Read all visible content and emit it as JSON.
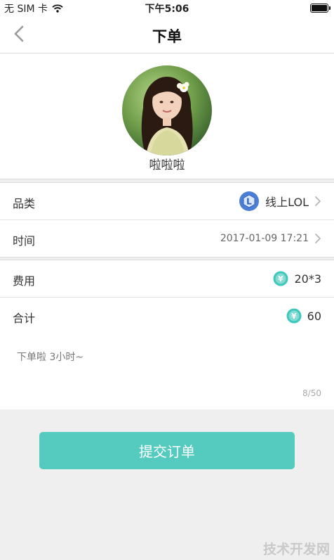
{
  "status_bar": {
    "carrier": "无 SIM 卡",
    "time": "下午5:06"
  },
  "nav": {
    "title": "下单"
  },
  "profile": {
    "name": "啦啦啦"
  },
  "order_rows": [
    {
      "label": "品类",
      "value": "线上LOL",
      "icon": "lol-game-icon"
    },
    {
      "label": "时间",
      "value": "2017-01-09 17:21"
    }
  ],
  "fee_rows": [
    {
      "label": "费用",
      "value": "20*3",
      "icon": "coin-icon"
    },
    {
      "label": "合计",
      "value": "60",
      "icon": "coin-icon"
    }
  ],
  "note": {
    "text": "下单啦 3小时~",
    "count": "8/50"
  },
  "submit": {
    "label": "提交订单"
  },
  "watermark": "技术开发网",
  "colors": {
    "accent": "#55cbc0",
    "coin": "#3ec7bd",
    "game_icon": "#4b7fd6",
    "background": "#efefef"
  }
}
